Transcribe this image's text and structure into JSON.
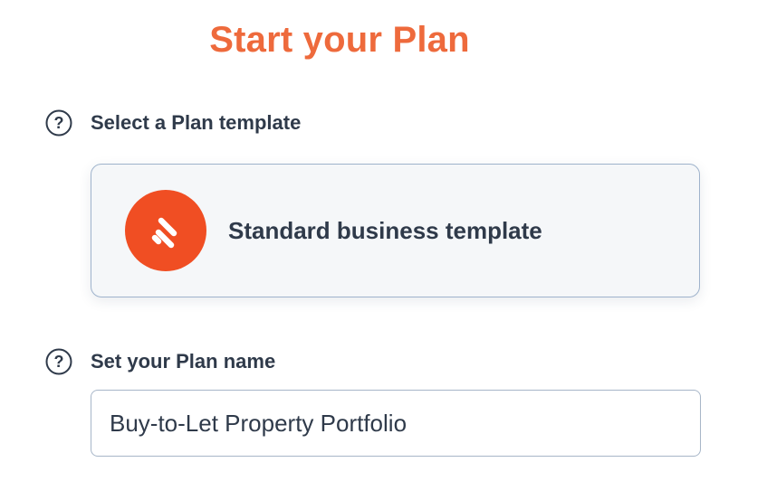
{
  "page": {
    "title": "Start your Plan"
  },
  "template_section": {
    "label": "Select a Plan template",
    "help_icon": "question-circle-icon",
    "card": {
      "name": "Standard business template",
      "logo_icon": "brand-slash-logo",
      "logo_color": "#f04e23"
    }
  },
  "name_section": {
    "label": "Set your Plan name",
    "help_icon": "question-circle-icon",
    "input_value": "Buy-to-Let Property Portfolio"
  },
  "colors": {
    "title": "#ee6a3c",
    "text": "#2f3a4a",
    "card_border": "#9fb3cc",
    "card_background": "#f5f7f9"
  }
}
